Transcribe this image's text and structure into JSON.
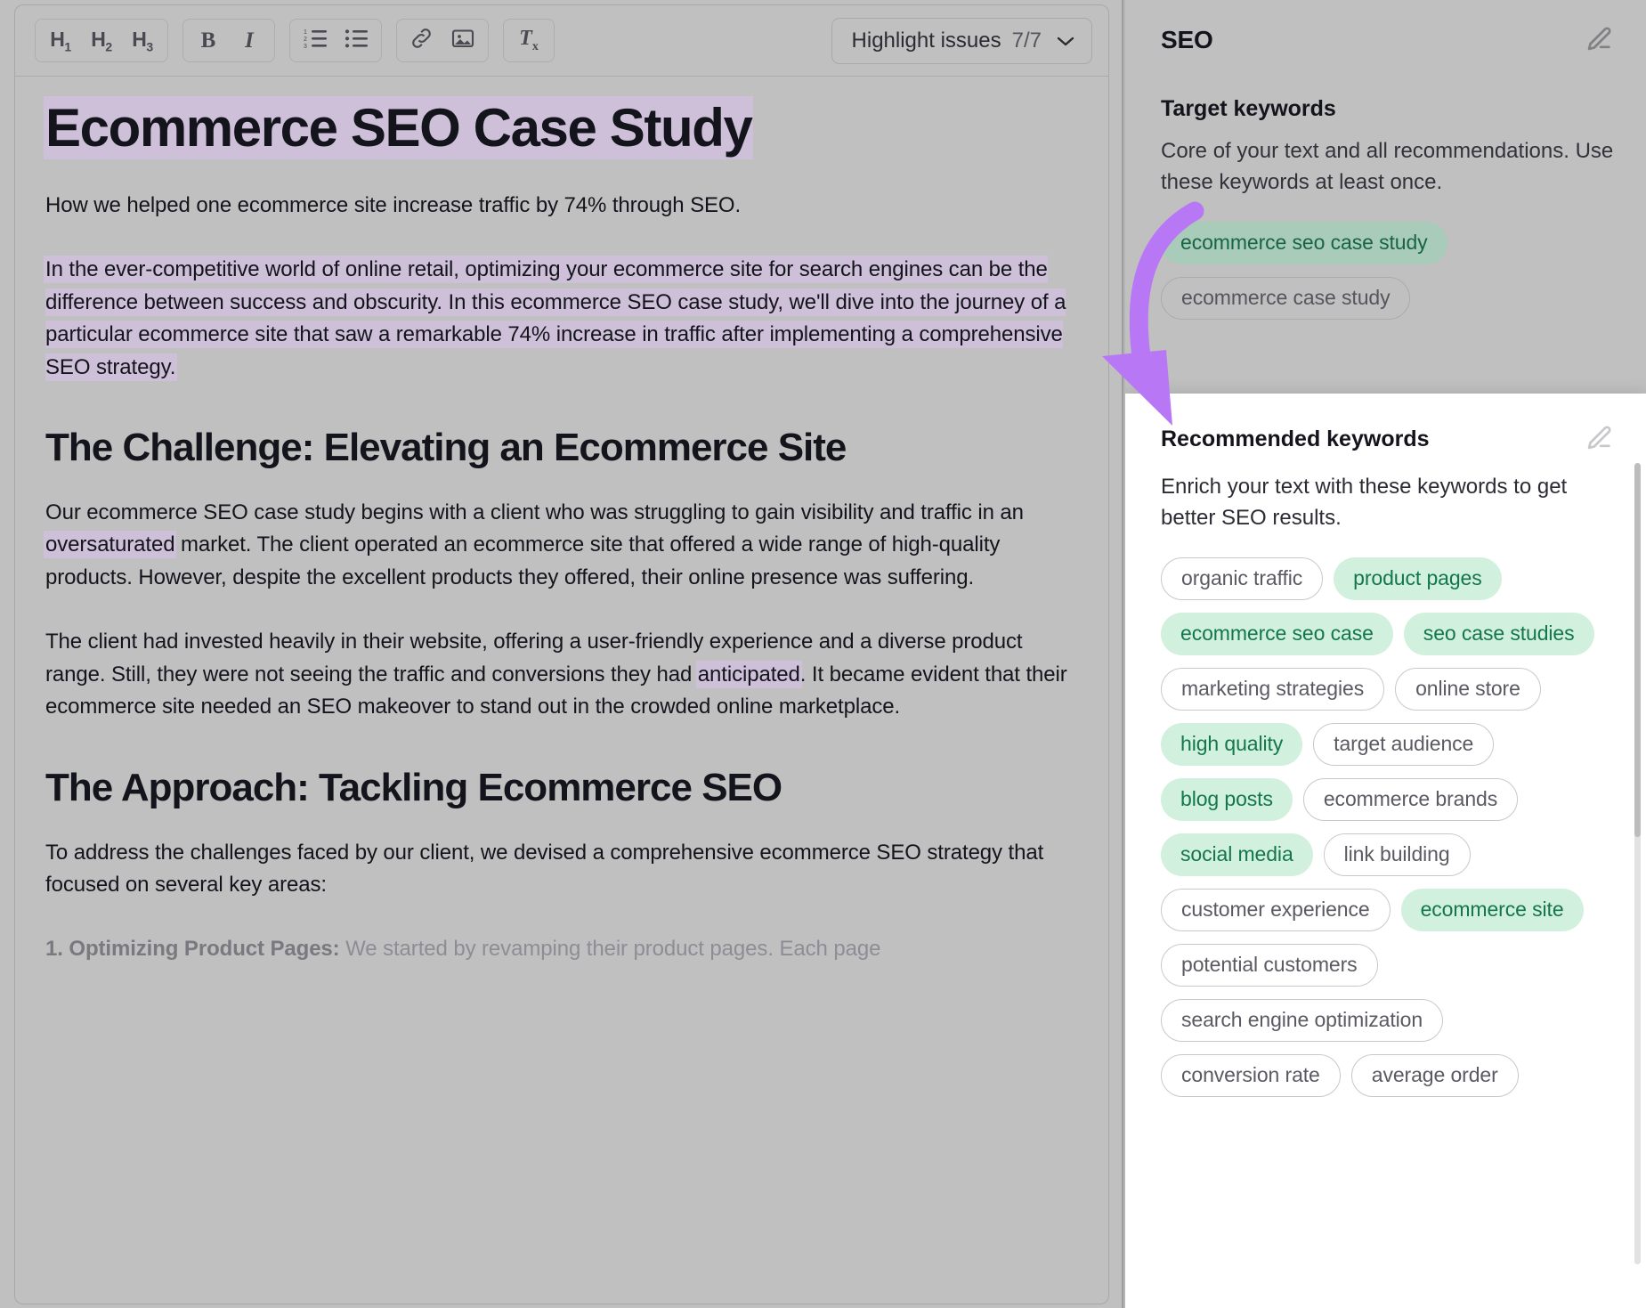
{
  "toolbar": {
    "heading_buttons": [
      {
        "name": "h1",
        "label": "H",
        "sub": "1"
      },
      {
        "name": "h2",
        "label": "H",
        "sub": "2"
      },
      {
        "name": "h3",
        "label": "H",
        "sub": "3"
      }
    ],
    "bold_label": "B",
    "italic_label": "I",
    "ordered_list_icon": "ordered-list-icon",
    "bullet_list_icon": "bullet-list-icon",
    "link_icon": "link-icon",
    "image_icon": "image-icon",
    "clear_format_label": "T",
    "clear_format_sub": "x",
    "highlight_issues": {
      "label": "Highlight issues",
      "count": "7/7",
      "chevron": "chevron-down-icon"
    }
  },
  "document": {
    "title": "Ecommerce SEO Case Study",
    "intro": "How we helped one ecommerce site increase traffic by 74% through SEO.",
    "paragraph_1": "In the ever-competitive world of online retail, optimizing your ecommerce site for search engines can be the difference between success and obscurity. In this ecommerce SEO case study, we'll dive into the journey of a particular ecommerce site that saw a remarkable 74% increase in traffic after implementing a comprehensive SEO strategy.",
    "heading_2": "The Challenge: Elevating an Ecommerce Site",
    "paragraph_2_a": "Our ecommerce SEO case study begins with a client who was struggling to gain visibility and traffic in an ",
    "paragraph_2_hl": "oversaturated",
    "paragraph_2_b": " market. The client operated an ecommerce site that offered a wide range of high-quality products. However, despite the excellent products they offered, their online presence was suffering.",
    "paragraph_3_a": "The client had invested heavily in their website, offering a user-friendly experience and a diverse product range. Still, they were not seeing the traffic and conversions they had ",
    "paragraph_3_hl": "anticipated",
    "paragraph_3_b": ". It became evident that their ecommerce site needed an SEO makeover to stand out in the crowded online marketplace.",
    "heading_3": "The Approach: Tackling Ecommerce SEO",
    "paragraph_4": "To address the challenges faced by our client, we devised a comprehensive ecommerce SEO strategy that focused on several key areas:",
    "list_item_1_bold": "1. Optimizing Product Pages:",
    "list_item_1_rest": " We started by revamping their product pages. Each page"
  },
  "seo_panel": {
    "title": "SEO",
    "edit_icon": "pencil-icon",
    "target_keywords": {
      "heading": "Target keywords",
      "description": "Core of your text and all recommendations. Use these keywords at least once.",
      "tags": [
        {
          "label": "ecommerce seo case study",
          "state": "used"
        },
        {
          "label": "ecommerce case study",
          "state": "unused"
        }
      ]
    },
    "recommended_keywords": {
      "heading": "Recommended keywords",
      "edit_icon": "pencil-icon",
      "description": "Enrich your text with these keywords to get better SEO results.",
      "tags": [
        {
          "label": "organic traffic",
          "state": "unused"
        },
        {
          "label": "product pages",
          "state": "used"
        },
        {
          "label": "ecommerce seo case",
          "state": "used"
        },
        {
          "label": "seo case studies",
          "state": "used"
        },
        {
          "label": "marketing strategies",
          "state": "unused"
        },
        {
          "label": "online store",
          "state": "unused"
        },
        {
          "label": "high quality",
          "state": "used"
        },
        {
          "label": "target audience",
          "state": "unused"
        },
        {
          "label": "blog posts",
          "state": "used"
        },
        {
          "label": "ecommerce brands",
          "state": "unused"
        },
        {
          "label": "social media",
          "state": "used"
        },
        {
          "label": "link building",
          "state": "unused"
        },
        {
          "label": "customer experience",
          "state": "unused"
        },
        {
          "label": "ecommerce site",
          "state": "used"
        },
        {
          "label": "potential customers",
          "state": "unused"
        },
        {
          "label": "search engine optimization",
          "state": "unused"
        },
        {
          "label": "conversion rate",
          "state": "unused"
        },
        {
          "label": "average order",
          "state": "unused"
        }
      ]
    }
  },
  "annotation": {
    "arrow_color": "#b878f5",
    "arrow_name": "purple-callout-arrow"
  },
  "colors": {
    "highlight_purple": "#cdc0d8",
    "tag_green_bg": "#d2f0de",
    "tag_green_text": "#13774b",
    "panel_bg": "#ffffff",
    "dim_overlay": "#c0c0c0"
  }
}
